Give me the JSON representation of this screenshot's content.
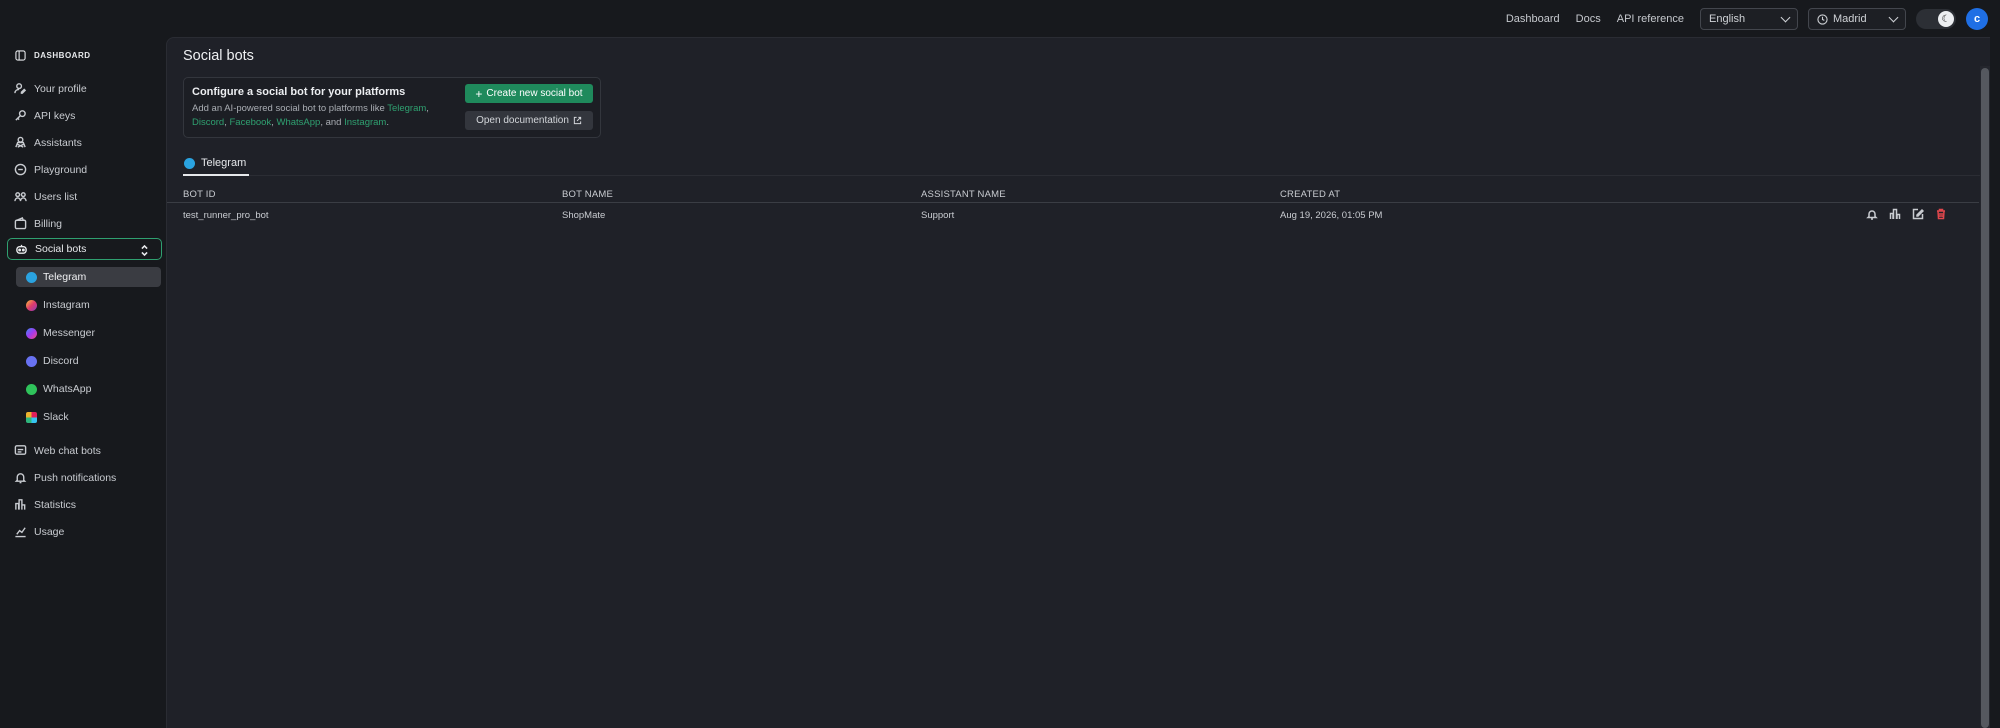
{
  "topbar": {
    "links": [
      "Dashboard",
      "Docs",
      "API reference"
    ],
    "language": "English",
    "timezone": "Madrid",
    "avatar_initial": "c"
  },
  "sidebar": {
    "brand": "DASHBOARD",
    "items_top": [
      "Your profile",
      "API keys",
      "Assistants",
      "Playground",
      "Users list",
      "Billing"
    ],
    "active": "Social bots",
    "sub_items": [
      "Telegram",
      "Instagram",
      "Messenger",
      "Discord",
      "WhatsApp",
      "Slack"
    ],
    "items_bottom": [
      "Web chat bots",
      "Push notifications",
      "Statistics",
      "Usage"
    ]
  },
  "main": {
    "title": "Social bots",
    "card": {
      "title": "Configure a social bot for your platforms",
      "desc_prefix": "Add an AI-powered social bot to platforms like ",
      "links": [
        "Telegram",
        "Discord",
        "Facebook",
        "WhatsApp",
        "Instagram"
      ],
      "and": "and",
      "create_label": "Create new social bot",
      "docs_label": "Open documentation"
    },
    "tab": "Telegram",
    "table": {
      "headers": [
        "BOT ID",
        "BOT NAME",
        "ASSISTANT NAME",
        "CREATED AT"
      ],
      "rows": [
        [
          "test_runner_pro_bot",
          "ShopMate",
          "Support",
          "Aug 19, 2026, 01:05 PM"
        ]
      ]
    }
  },
  "colors": {
    "accent": "#2fa070",
    "button": "#1f8a5c",
    "delete": "#e0474c",
    "avatar": "#1f6fe5"
  }
}
